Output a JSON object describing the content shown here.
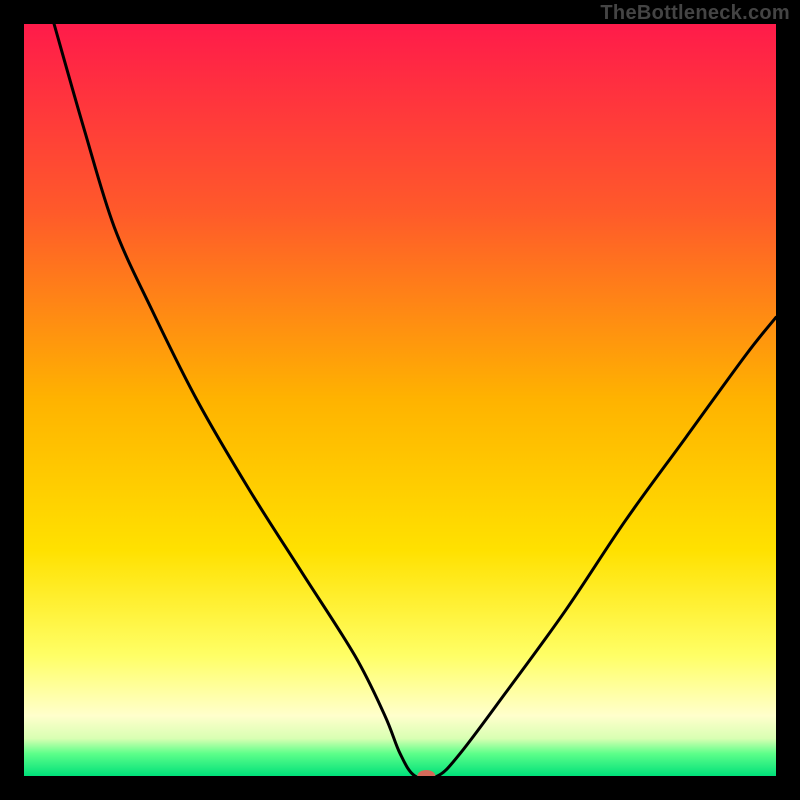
{
  "watermark": "TheBottleneck.com",
  "chart_data": {
    "type": "line",
    "title": "",
    "xlabel": "",
    "ylabel": "",
    "xlim": [
      0,
      100
    ],
    "ylim": [
      0,
      100
    ],
    "background_gradient_stops": [
      {
        "offset": 0,
        "color": "#ff1b4a"
      },
      {
        "offset": 25,
        "color": "#ff5a2a"
      },
      {
        "offset": 50,
        "color": "#ffb300"
      },
      {
        "offset": 70,
        "color": "#ffe100"
      },
      {
        "offset": 84,
        "color": "#ffff66"
      },
      {
        "offset": 92,
        "color": "#ffffcc"
      },
      {
        "offset": 95,
        "color": "#d9ffb3"
      },
      {
        "offset": 97,
        "color": "#5eff8a"
      },
      {
        "offset": 100,
        "color": "#00e07a"
      }
    ],
    "series": [
      {
        "name": "bottleneck-curve",
        "color": "#000000",
        "x": [
          4,
          8,
          12,
          17,
          23,
          30,
          37,
          44,
          48,
          50,
          52,
          55,
          58,
          64,
          72,
          80,
          88,
          96,
          100
        ],
        "y": [
          100,
          86,
          73,
          62,
          50,
          38,
          27,
          16,
          8,
          3,
          0,
          0,
          3,
          11,
          22,
          34,
          45,
          56,
          61
        ]
      }
    ],
    "marker": {
      "name": "optimal-point",
      "x": 53.5,
      "y": 0,
      "color": "#d46a5a",
      "rx": 9,
      "ry": 6
    }
  }
}
